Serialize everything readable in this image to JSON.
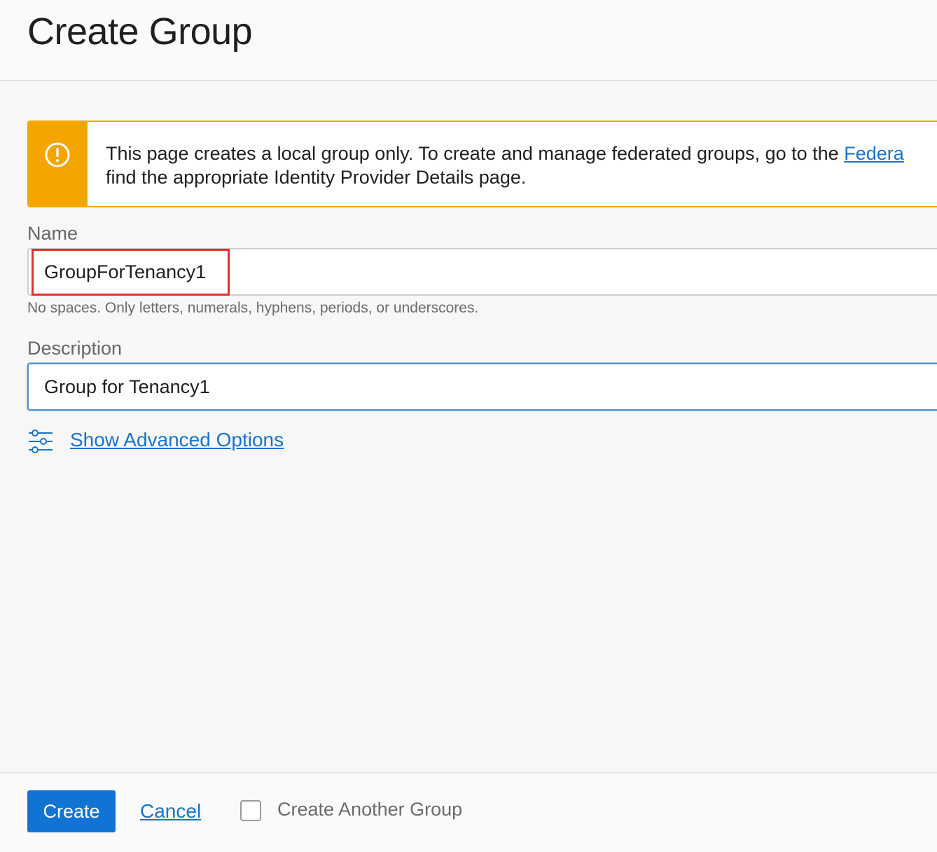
{
  "header": {
    "title": "Create Group"
  },
  "banner": {
    "line1_prefix": "This page creates a local group only. To create and manage federated groups, go to the ",
    "link_text": "Federa",
    "line2": "find the appropriate Identity Provider Details page.",
    "icon": "exclamation-circle-icon",
    "accent_color": "#f5a500"
  },
  "form": {
    "name_label": "Name",
    "name_value": "GroupForTenancy1",
    "name_hint": "No spaces. Only letters, numerals, hyphens, periods, or underscores.",
    "description_label": "Description",
    "description_value": "Group for Tenancy1",
    "advanced_link": "Show Advanced Options",
    "advanced_icon": "sliders-icon"
  },
  "footer": {
    "create_label": "Create",
    "cancel_label": "Cancel",
    "create_another_label": "Create Another Group",
    "create_another_checked": false,
    "primary_color": "#1173d4"
  }
}
